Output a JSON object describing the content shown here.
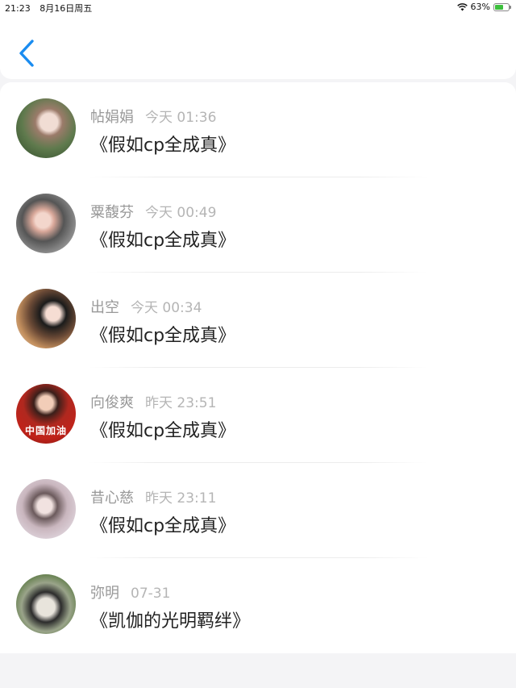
{
  "status_bar": {
    "time": "21:23",
    "date": "8月16日周五",
    "battery_percent": "63%",
    "battery_level": 0.63,
    "icons": [
      "wifi-icon",
      "battery-charging-icon"
    ]
  },
  "nav": {
    "back_icon": "chevron-left-icon",
    "accent_color": "#1a8cf0"
  },
  "items": [
    {
      "name": "帖娟娟",
      "time": "今天 01:36",
      "title": "《假如cp全成真》",
      "avatar_tag": ""
    },
    {
      "name": "粟馥芬",
      "time": "今天 00:49",
      "title": "《假如cp全成真》",
      "avatar_tag": ""
    },
    {
      "name": "出空",
      "time": "今天 00:34",
      "title": "《假如cp全成真》",
      "avatar_tag": ""
    },
    {
      "name": "向俊爽",
      "time": "昨天 23:51",
      "title": "《假如cp全成真》",
      "avatar_tag": "中国加油"
    },
    {
      "name": "昔心慈",
      "time": "昨天 23:11",
      "title": "《假如cp全成真》",
      "avatar_tag": ""
    },
    {
      "name": "弥明",
      "time": "07-31",
      "title": "《凯伽的光明羁绊》",
      "avatar_tag": ""
    }
  ]
}
